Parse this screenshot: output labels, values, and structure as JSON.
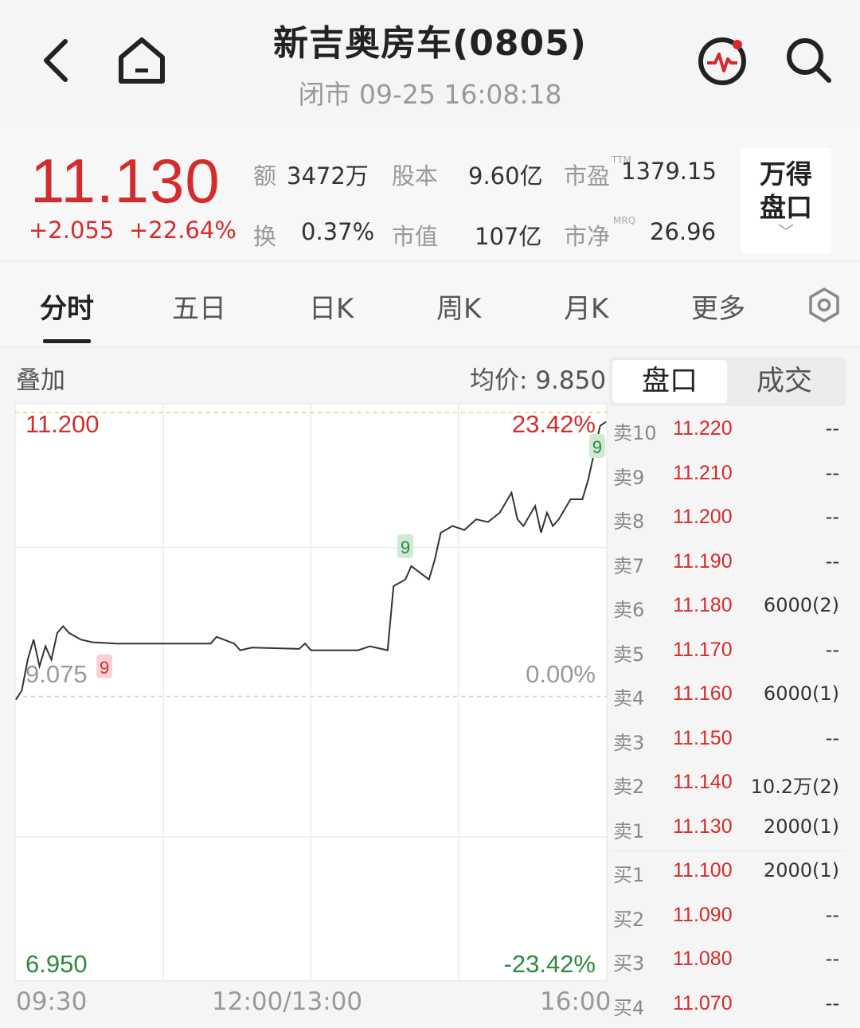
{
  "header": {
    "title": "新吉奥房车(0805)",
    "subtitle": "闭市 09-25 16:08:18",
    "icons": [
      "back-icon",
      "home-icon",
      "pulse-icon",
      "search-icon"
    ]
  },
  "quote": {
    "price": "11.130",
    "change": "+2.055",
    "change_pct": "+22.64%",
    "stats": [
      {
        "label": "额",
        "value": "3472万"
      },
      {
        "label": "股本",
        "value": "9.60亿"
      },
      {
        "label": "市盈",
        "sup": "TTM",
        "value": "1379.15"
      },
      {
        "label": "换",
        "value": "0.37%"
      },
      {
        "label": "市值",
        "value": "107亿"
      },
      {
        "label": "市净",
        "sup": "MRQ",
        "value": "26.96"
      }
    ],
    "wande_line1": "万得",
    "wande_line2": "盘口",
    "wande_chevron": "﹀"
  },
  "tabs": [
    "分时",
    "五日",
    "日K",
    "周K",
    "月K",
    "更多"
  ],
  "active_tab": "分时",
  "chart": {
    "overlay_label": "叠加",
    "avg_label": "均价: 9.850",
    "y_top": "11.200",
    "y_mid": "9.075",
    "y_bottom": "6.950",
    "pct_top": "23.42%",
    "pct_mid": "0.00%",
    "pct_bottom": "-23.42%",
    "x_labels": [
      "09:30",
      "12:00/13:00",
      "16:00"
    ],
    "markers": [
      "9",
      "9",
      "9"
    ],
    "colors": {
      "up": "#d42c2c",
      "down": "#2a8a3e",
      "line": "#333333"
    }
  },
  "chart_data": {
    "type": "line",
    "title": "",
    "xlabel": "",
    "ylabel": "",
    "ylim": [
      6.95,
      11.2
    ],
    "x_ticks": [
      "09:30",
      "12:00/13:00",
      "16:00"
    ],
    "series": [
      {
        "values": [
          [
            0,
            9.05
          ],
          [
            0.01,
            9.12
          ],
          [
            0.02,
            9.35
          ],
          [
            0.03,
            9.5
          ],
          [
            0.04,
            9.3
          ],
          [
            0.05,
            9.45
          ],
          [
            0.06,
            9.35
          ],
          [
            0.07,
            9.55
          ],
          [
            0.08,
            9.6
          ],
          [
            0.09,
            9.55
          ],
          [
            0.11,
            9.5
          ],
          [
            0.13,
            9.48
          ],
          [
            0.17,
            9.47
          ],
          [
            0.25,
            9.47
          ],
          [
            0.33,
            9.47
          ],
          [
            0.34,
            9.52
          ],
          [
            0.37,
            9.47
          ],
          [
            0.38,
            9.42
          ],
          [
            0.4,
            9.44
          ],
          [
            0.48,
            9.43
          ],
          [
            0.49,
            9.47
          ],
          [
            0.5,
            9.42
          ],
          [
            0.58,
            9.42
          ],
          [
            0.6,
            9.45
          ],
          [
            0.63,
            9.42
          ],
          [
            0.64,
            9.9
          ],
          [
            0.66,
            9.95
          ],
          [
            0.67,
            10.05
          ],
          [
            0.7,
            9.95
          ],
          [
            0.71,
            10.1
          ],
          [
            0.72,
            10.3
          ],
          [
            0.74,
            10.35
          ],
          [
            0.76,
            10.32
          ],
          [
            0.78,
            10.4
          ],
          [
            0.8,
            10.38
          ],
          [
            0.82,
            10.45
          ],
          [
            0.84,
            10.6
          ],
          [
            0.85,
            10.4
          ],
          [
            0.86,
            10.35
          ],
          [
            0.88,
            10.5
          ],
          [
            0.89,
            10.3
          ],
          [
            0.9,
            10.45
          ],
          [
            0.91,
            10.35
          ],
          [
            0.92,
            10.4
          ],
          [
            0.94,
            10.55
          ],
          [
            0.96,
            10.55
          ],
          [
            0.97,
            10.7
          ],
          [
            0.98,
            10.9
          ],
          [
            0.99,
            11.1
          ],
          [
            1.0,
            11.13
          ]
        ]
      }
    ],
    "reference_lines": [
      11.2,
      9.075
    ]
  },
  "orderbook": {
    "tab_active": "盘口",
    "tab_inactive": "成交",
    "rows": [
      {
        "label": "卖10",
        "price": "11.220",
        "vol": "--"
      },
      {
        "label": "卖9",
        "price": "11.210",
        "vol": "--"
      },
      {
        "label": "卖8",
        "price": "11.200",
        "vol": "--"
      },
      {
        "label": "卖7",
        "price": "11.190",
        "vol": "--"
      },
      {
        "label": "卖6",
        "price": "11.180",
        "vol": "6000(2)"
      },
      {
        "label": "卖5",
        "price": "11.170",
        "vol": "--"
      },
      {
        "label": "卖4",
        "price": "11.160",
        "vol": "6000(1)"
      },
      {
        "label": "卖3",
        "price": "11.150",
        "vol": "--"
      },
      {
        "label": "卖2",
        "price": "11.140",
        "vol": "10.2万(2)"
      },
      {
        "label": "卖1",
        "price": "11.130",
        "vol": "2000(1)"
      },
      {
        "label": "买1",
        "price": "11.100",
        "vol": "2000(1)"
      },
      {
        "label": "买2",
        "price": "11.090",
        "vol": "--"
      },
      {
        "label": "买3",
        "price": "11.080",
        "vol": "--"
      },
      {
        "label": "买4",
        "price": "11.070",
        "vol": "--"
      }
    ]
  }
}
